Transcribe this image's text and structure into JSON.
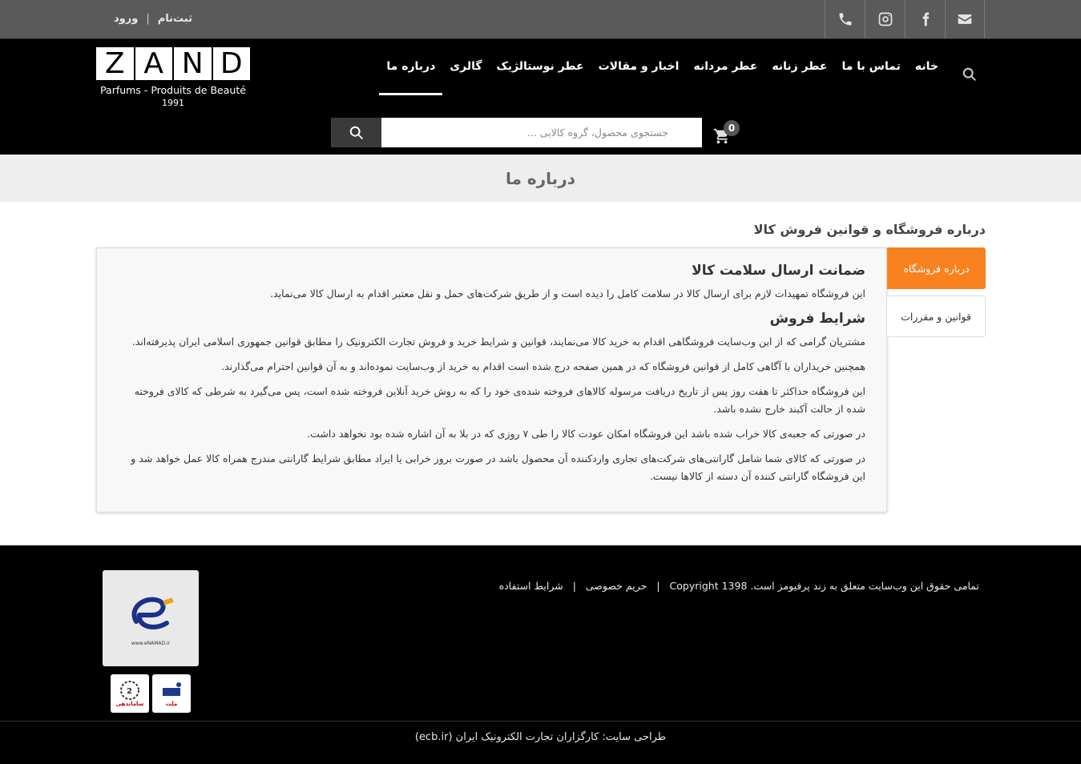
{
  "topbar": {
    "auth": {
      "register": "ثبت‌نام",
      "login": "ورود",
      "separator": "|"
    },
    "social": [
      {
        "icon": "phone-icon"
      },
      {
        "icon": "instagram-icon"
      },
      {
        "icon": "facebook-icon"
      },
      {
        "icon": "email-icon"
      }
    ]
  },
  "header": {
    "logo": {
      "letters": [
        "Z",
        "A",
        "N",
        "D"
      ],
      "subtitle": "Parfums - Produits de Beauté",
      "year": "1991"
    },
    "nav": [
      {
        "label": "خانه",
        "active": false
      },
      {
        "label": "تماس با ما",
        "active": false
      },
      {
        "label": "عطر زنانه",
        "active": false
      },
      {
        "label": "عطر مردانه",
        "active": false
      },
      {
        "label": "اخبار و مقالات",
        "active": false
      },
      {
        "label": "عطر نوستالژیک",
        "active": false
      },
      {
        "label": "گالری",
        "active": false
      },
      {
        "label": "درباره ما",
        "active": true
      }
    ],
    "cart_count": "0",
    "search_placeholder": "جستجوی محصول، گروه کالایی ..."
  },
  "page": {
    "title": "درباره ما",
    "section_title": "درباره فروشگاه و قوانین فروش کالا",
    "tabs": [
      {
        "label": "درباره فروشگاه",
        "active": true
      },
      {
        "label": "قوانین و مقررات",
        "active": false
      }
    ],
    "content": {
      "heading1": "ضمانت ارسال سلامت کالا",
      "para1": "این فروشگاه تمهیدات لازم برای ارسال کالا در سلامت کامل را دیده است و از طریق شرکت‌های حمل و نقل معتبر اقدام به ارسال کالا می‌نماید.",
      "heading2": "شرایط فروش",
      "paragraphs": [
        "مشتریان گرامی که از این وب‌سایت فروشگاهی اقدام به خرید کالا می‌نمایند، قوانین و شرایط خرید و فروش تجارت الکترونیک را مطابق قوانین جمهوری اسلامی ایران پذیرفته‌اند.",
        "همچنین خریداران با آگاهی کامل از قوانین فروشگاه که در همین صفحه درج شده است اقدام به خرید از وب‌سایت نموده‌اند و به آن قوانین احترام می‌گذارند.",
        "این فروشگاه حداکثر تا هفت روز پس از تاریخ دریافت مرسوله کالاهای فروخته شده‌ی خود را که به روش خرید آنلاین فروخته شده است، پس می‌گیرد به شرطی که کالای فروخته شده از حالت آکبند خارج نشده باشد.",
        "در صورتی که جعبه‌ی کالا خراب شده باشد این فروشگاه امکان عودت کالا را طی ۷ روزی که در بلا به آن اشاره شده بود نخواهد داشت.",
        "در صورتی که کالای شما شامل گارانتی‌های شرکت‌های تجاری واردکننده آن محصول باشد در صورت بروز خرابی یا ایراد مطابق شرایط گارانتی مندرج همراه کالا عمل خواهد شد و این فروشگاه گارانتی کننده آن دسته از کالاها نیست."
      ]
    }
  },
  "footer": {
    "copyright": "تمامی حقوق این وب‌سایت متعلق به زند پرفیومز است. Copyright 1398",
    "privacy": "حریم خصوصی",
    "terms": "شرایط استفاده",
    "separator": "|",
    "enamad_text": "www.eNAMAD.ir",
    "badge_mellat": "ملت",
    "badge_samandehi": "ساماندهی",
    "credit": "طراحی سایت: کارگزاران تجارت الکترونیک ایران (ecb.ir)"
  }
}
